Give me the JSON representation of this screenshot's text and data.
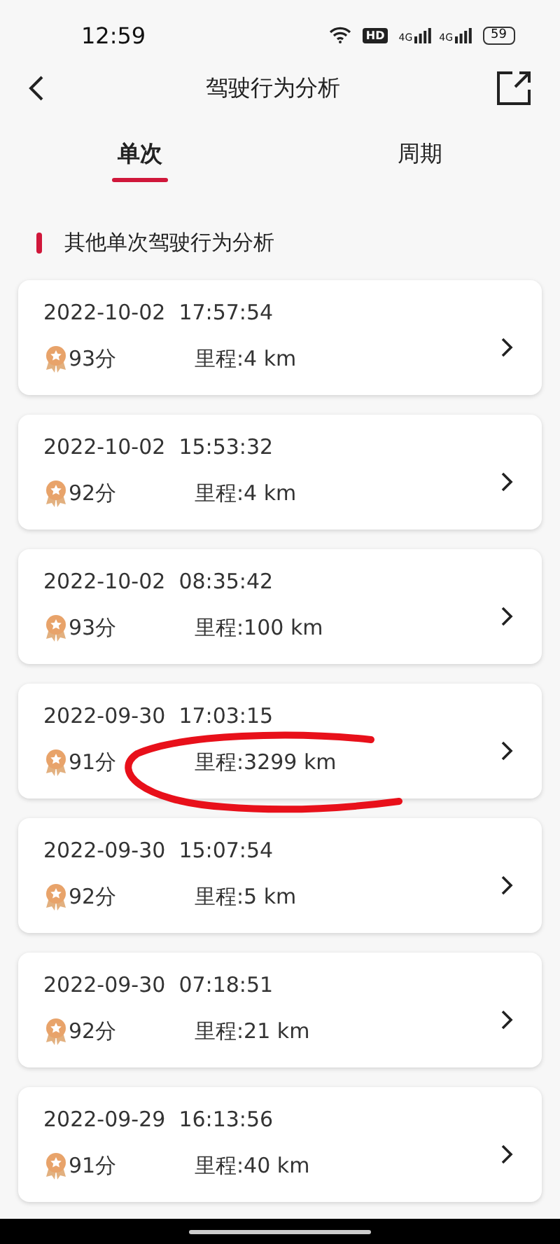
{
  "status_bar": {
    "time": "12:59",
    "hd": "HD",
    "networks": [
      "4G",
      "4G"
    ],
    "battery": "59"
  },
  "header": {
    "title": "驾驶行为分析"
  },
  "tabs": [
    {
      "label": "单次",
      "selected": true
    },
    {
      "label": "周期",
      "selected": false
    }
  ],
  "section": {
    "title": "其他单次驾驶行为分析"
  },
  "trips": [
    {
      "datetime": "2022-10-02  17:57:54",
      "score": "93分",
      "distance": "里程:4 km"
    },
    {
      "datetime": "2022-10-02  15:53:32",
      "score": "92分",
      "distance": "里程:4 km"
    },
    {
      "datetime": "2022-10-02  08:35:42",
      "score": "93分",
      "distance": "里程:100 km"
    },
    {
      "datetime": "2022-09-30  17:03:15",
      "score": "91分",
      "distance": "里程:3299 km"
    },
    {
      "datetime": "2022-09-30  15:07:54",
      "score": "92分",
      "distance": "里程:5 km"
    },
    {
      "datetime": "2022-09-30  07:18:51",
      "score": "92分",
      "distance": "里程:21 km"
    },
    {
      "datetime": "2022-09-29  16:13:56",
      "score": "91分",
      "distance": "里程:40 km"
    }
  ]
}
